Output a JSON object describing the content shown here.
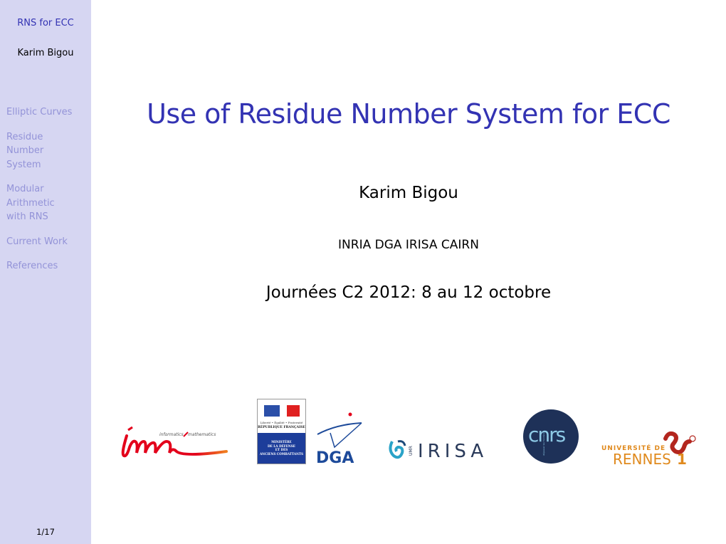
{
  "sidebar": {
    "short_title": "RNS for ECC",
    "author": "Karim Bigou",
    "sections": [
      {
        "label": "Elliptic Curves"
      },
      {
        "label": "Residue Number System"
      },
      {
        "label": "Modular Arithmetic with RNS"
      },
      {
        "label": "Current Work"
      },
      {
        "label": "References"
      }
    ],
    "page_indicator": "1/17"
  },
  "slide": {
    "title": "Use of Residue Number System for ECC",
    "author": "Karim Bigou",
    "institutions": "INRIA DGA IRISA CAIRN",
    "event": "Journées C2 2012: 8 au 12 octobre"
  },
  "logos": {
    "inria": {
      "name": "Inria",
      "tagline_left": "informatics",
      "tagline_right": "mathematics"
    },
    "ministry": {
      "motto": "Liberté • Égalité • Fraternité",
      "republic": "RÉPUBLIQUE FRANÇAISE",
      "lines": [
        "MINISTÈRE",
        "DE LA DÉFENSE",
        "ET DES",
        "ANCIENS COMBATTANTS"
      ]
    },
    "dga": {
      "name": "DGA"
    },
    "irisa": {
      "prefix": "UMR",
      "name": "IRISA"
    },
    "cnrs": {
      "name": "cnrs",
      "tagline": "dépasser les frontières"
    },
    "rennes": {
      "line1": "UNIVERSITÉ DE",
      "line2": "RENNES",
      "number": "1"
    }
  },
  "colors": {
    "sidebar_bg": "#d6d6f2",
    "title": "#3333b3",
    "nav_inactive": "#9393d8"
  }
}
